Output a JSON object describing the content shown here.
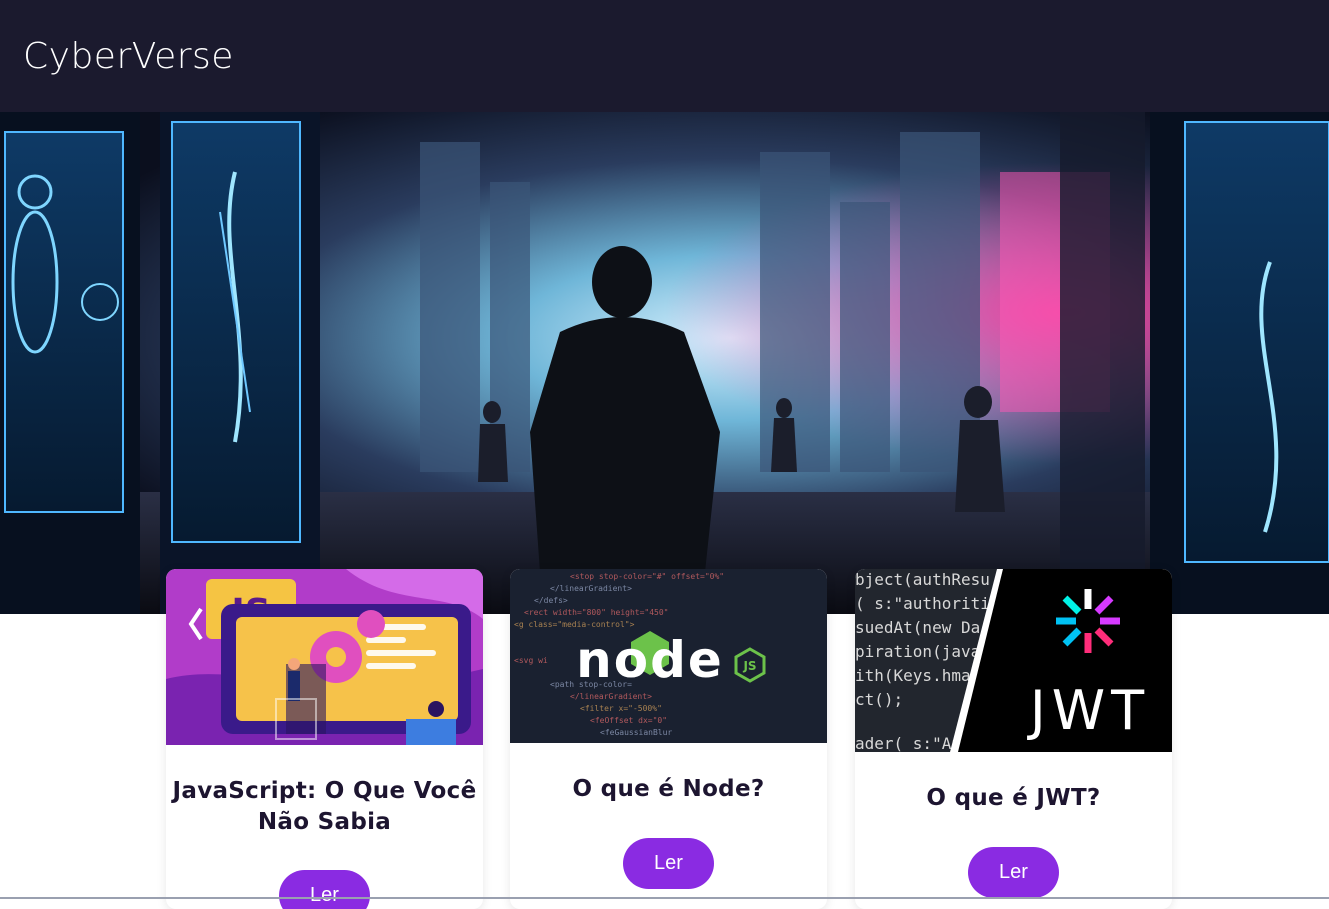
{
  "navbar": {
    "brand": "CyberVerse"
  },
  "hero": {
    "image": "cyberpunk-city-hero-image"
  },
  "cards": [
    {
      "title": "JavaScript: O Que Você Não Sabia",
      "button": "Ler",
      "image": "javascript-illustration"
    },
    {
      "title": "O que é Node?",
      "button": "Ler",
      "image": "nodejs-code-image"
    },
    {
      "title": "O que é JWT?",
      "button": "Ler",
      "image": "jwt-logo-image"
    }
  ],
  "thumb_text": {
    "js_logo": "JS",
    "node_logo": "node",
    "node_badge": "JS",
    "jwt_logo": "JWT",
    "jwt_code": [
      "bject(authResu",
      "( s:\"authoriti",
      "suedAt(new Da",
      "piration(java",
      "ith(Keys.hma",
      "ct();",
      "ader( s:\"Au"
    ],
    "node_code": [
      "<stop stop-color=\"#\" offset=\"0%\"",
      "</linearGradient>",
      "</defs>",
      "<rect width=\"800\" height=\"450\"",
      "<g class=\"media-control\">",
      "<svg wi",
      "<path stop-color=",
      "</linearGradient>",
      "<filter x=\"-500%\"",
      "<feOffset dx=\"0\"",
      "<feGaussianBlur"
    ]
  },
  "colors": {
    "navbar": "#1b1a2e",
    "accent": "#8a2be2",
    "title": "#1d1530"
  }
}
